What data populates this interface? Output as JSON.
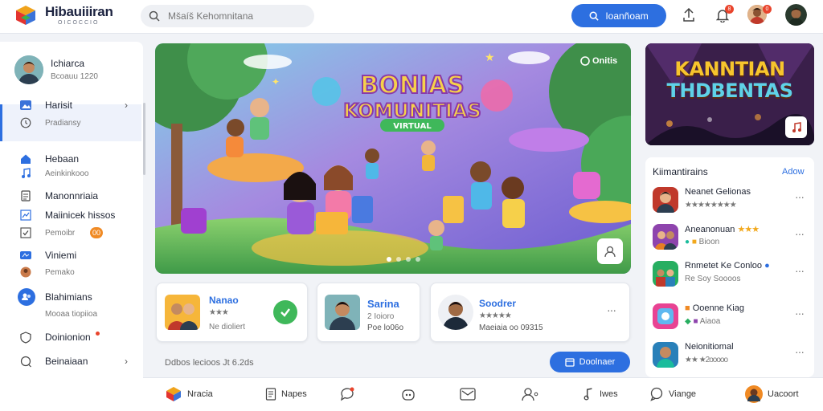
{
  "app": {
    "title": "Hibauiiiran",
    "subtitle": "OICOCCIO"
  },
  "search": {
    "placeholder": "Mšaíš Kehomnitana"
  },
  "header": {
    "cta_label": "Ioanñoam",
    "notif_badge": "8",
    "avatar_badge": "0"
  },
  "profile": {
    "name": "Ichiarca",
    "sub": "Bcoauu 1220"
  },
  "sidebar": {
    "items": [
      {
        "label": "Harisit",
        "icon": "image-icon"
      },
      {
        "label": "Pradiansy",
        "icon": "clock-icon",
        "sub": true
      },
      {
        "label": "Hebaan",
        "icon": "home-icon"
      },
      {
        "label": "Aeinkinkooo",
        "icon": "music-icon",
        "sub": true
      },
      {
        "label": "Manonnriaia",
        "icon": "document-icon"
      },
      {
        "label": "Maiinicek hissos",
        "icon": "chart-icon"
      },
      {
        "label": "Pemoibr",
        "icon": "check-icon",
        "sub": true,
        "badge": "00"
      },
      {
        "label": "Viniemi",
        "icon": "video-icon"
      },
      {
        "label": "Pemako",
        "icon": "user-icon",
        "sub": true
      },
      {
        "label": "Blahimians",
        "icon": "people-icon"
      },
      {
        "label": "Mooaa tiopiioa",
        "icon": "",
        "sub": true
      },
      {
        "label": "Doinionion",
        "icon": "shield-icon"
      },
      {
        "label": "Beinaiaan",
        "icon": "chat-icon"
      }
    ]
  },
  "hero": {
    "badge": "Onitis",
    "title_line1": "BONIAS",
    "title_line2": "KOMUNITIAS",
    "title_line3": "VIRTUAL",
    "slide": 1,
    "slides": 4
  },
  "banner": {
    "line1": "KANNTIAN",
    "line2": "THDBENTAS"
  },
  "community": {
    "title": "Kiimantirains",
    "see_all": "Adow",
    "items": [
      {
        "name": "Neanet Gelionas",
        "meta": "★★★★★★★★",
        "colors": [
          "#c0392b",
          "#2c3e50"
        ]
      },
      {
        "name": "Aneanonuan",
        "meta": "Bioon",
        "stars": "★★★",
        "colors": [
          "#8e44ad",
          "#e67e22"
        ]
      },
      {
        "name": "Rnmetet Ke Conloo",
        "meta": "Re Soy Soooos",
        "colors": [
          "#27ae60",
          "#c0392b"
        ]
      },
      {
        "name": "Ooenne Kiag",
        "meta": "Aiaoa",
        "colors": [
          "#e84393",
          "#3498db"
        ]
      },
      {
        "name": "Neionitiomal",
        "meta": "★★ ★2ooooo",
        "colors": [
          "#2980b9",
          "#1abc9c"
        ]
      }
    ]
  },
  "user_cards": [
    {
      "name": "Nanao",
      "stars": "★★★",
      "meta": "Ne dioliert"
    },
    {
      "name": "Sarina",
      "meta": "2 Ioioro",
      "stat": "Poe lo06o"
    },
    {
      "name": "Soodrer",
      "meta": "★★★★★",
      "stat": "Maeiaia oo 09315"
    }
  ],
  "footer": {
    "text": "Ddbos lecioos  Jt  6.2ds",
    "button": "Doolnaer"
  },
  "bottom_nav": [
    {
      "label": "Nracia",
      "icon": "colorful-logo-icon"
    },
    {
      "label": "Napes",
      "icon": "document-icon"
    },
    {
      "label": "",
      "icon": "chat-icon"
    },
    {
      "label": "",
      "icon": "bot-icon"
    },
    {
      "label": "",
      "icon": "mail-icon"
    },
    {
      "label": "",
      "icon": "people-icon"
    },
    {
      "label": "Iwes",
      "icon": "music-icon"
    },
    {
      "label": "Viange",
      "icon": "chat-bubble-icon"
    },
    {
      "label": "Uacoort",
      "icon": "avatar"
    }
  ]
}
